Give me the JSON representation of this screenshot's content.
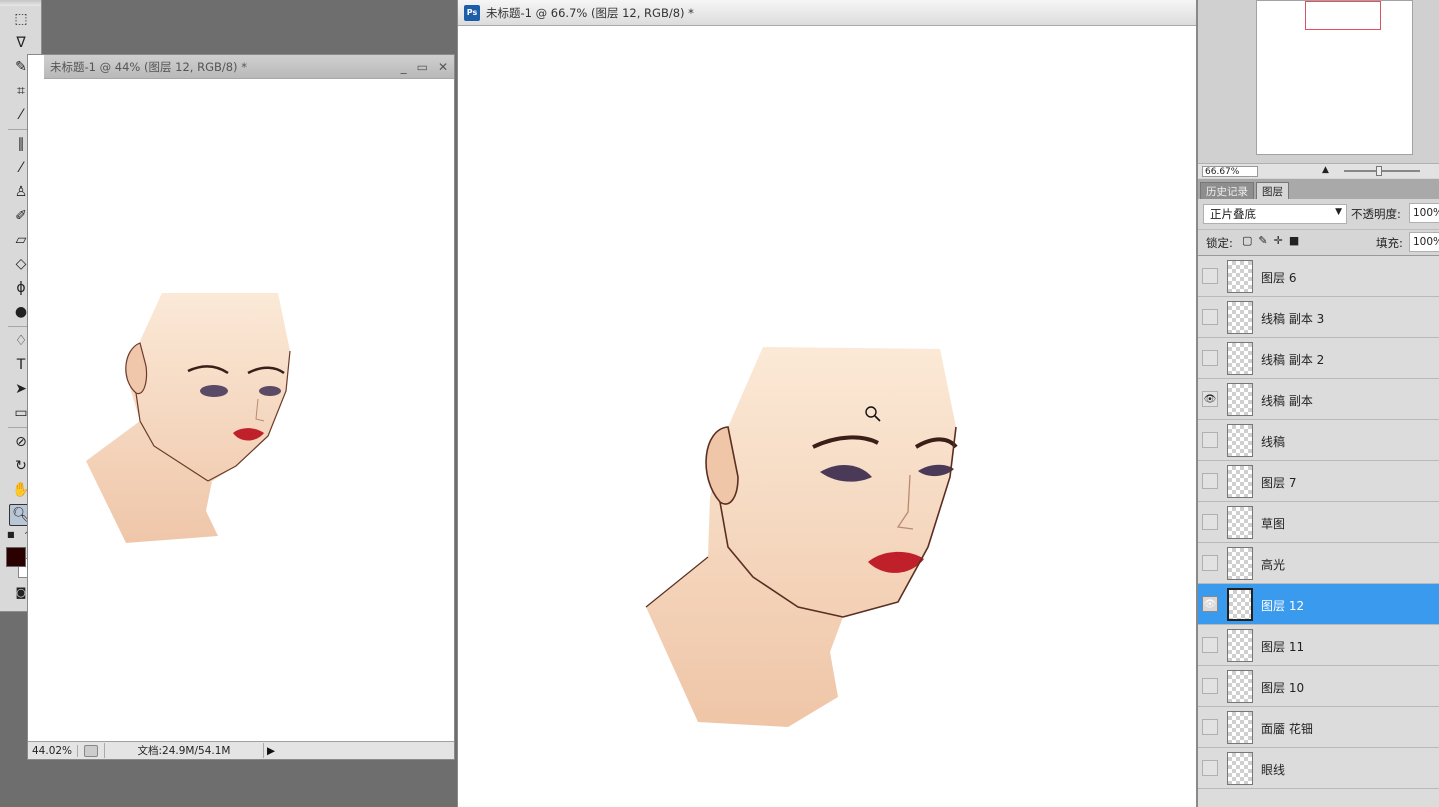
{
  "toolbox": {
    "tools": [
      "marquee-tool",
      "lasso-tool",
      "magic-wand-tool",
      "crop-tool",
      "eyedropper-tool",
      "healing-brush-tool",
      "brush-tool",
      "clone-stamp-tool",
      "history-brush-tool",
      "eraser-tool",
      "paint-bucket-tool",
      "blur-tool",
      "dodge-tool",
      "pen-tool",
      "type-tool",
      "path-selection-tool",
      "rectangle-tool",
      "notes-tool",
      "eyedropper-3d-tool",
      "hand-tool",
      "zoom-tool"
    ],
    "type_glyph": "T",
    "colors": {
      "foreground": "#2a0000",
      "background": "#ffffff"
    }
  },
  "window_small": {
    "title": "未标题-1 @ 44% (图层 12, RGB/8) *",
    "status_zoom": "44.02%",
    "status_info": "文档:24.9M/54.1M"
  },
  "window_main": {
    "title": "未标题-1 @ 66.7% (图层 12, RGB/8) *",
    "app_badge": "Ps"
  },
  "navigator": {
    "zoom": "66.67%"
  },
  "panel_tabs": [
    {
      "label": "历史记录",
      "active": false
    },
    {
      "label": "图层",
      "active": true
    }
  ],
  "layers_panel": {
    "blend_mode": "正片叠底",
    "opacity_label": "不透明度:",
    "opacity_value": "100%",
    "lock_label": "锁定:",
    "fill_label": "填充:",
    "fill_value": "100%"
  },
  "layers": [
    {
      "name": "图层 6",
      "visible": false,
      "selected": false
    },
    {
      "name": "线稿 副本 3",
      "visible": false,
      "selected": false
    },
    {
      "name": "线稿 副本 2",
      "visible": false,
      "selected": false
    },
    {
      "name": "线稿 副本",
      "visible": true,
      "selected": false
    },
    {
      "name": "线稿",
      "visible": false,
      "selected": false
    },
    {
      "name": "图层 7",
      "visible": false,
      "selected": false
    },
    {
      "name": "草图",
      "visible": false,
      "selected": false
    },
    {
      "name": "高光",
      "visible": false,
      "selected": false
    },
    {
      "name": "图层 12",
      "visible": true,
      "selected": true
    },
    {
      "name": "图层 11",
      "visible": false,
      "selected": false
    },
    {
      "name": "图层 10",
      "visible": false,
      "selected": false
    },
    {
      "name": "面靥 花钿",
      "visible": false,
      "selected": false
    },
    {
      "name": "眼线",
      "visible": false,
      "selected": false
    }
  ],
  "colors": {
    "selection": "#3a9aee",
    "skin": "#f6dcc6",
    "lips": "#c0202a"
  }
}
